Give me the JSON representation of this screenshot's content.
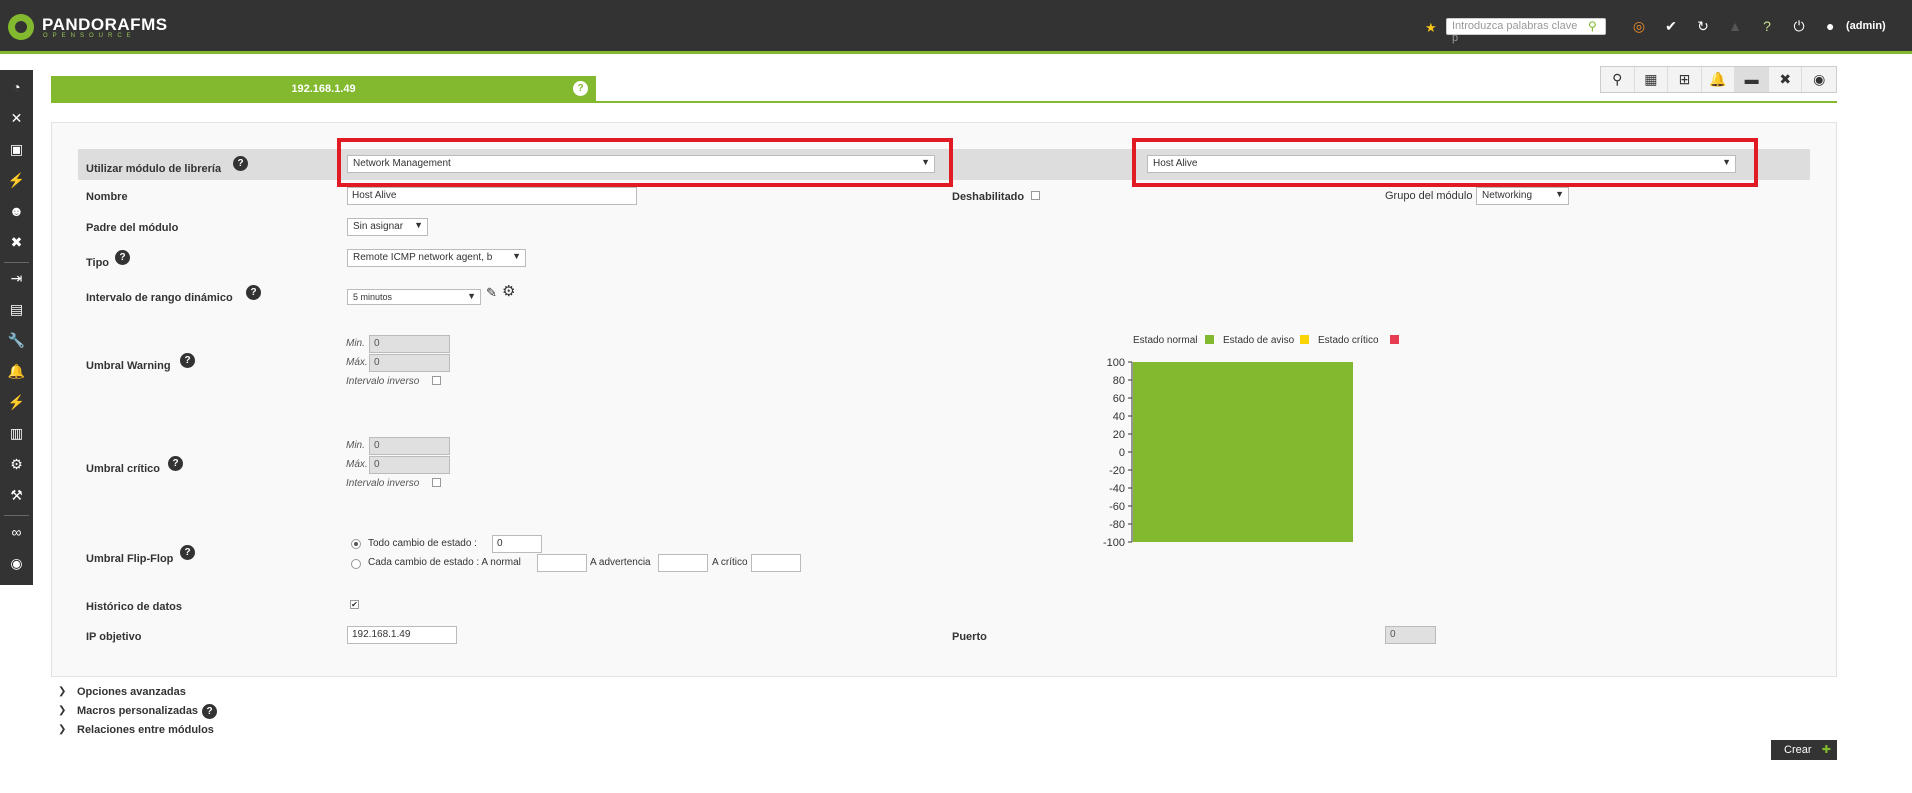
{
  "header": {
    "brand": "PANDORAFMS",
    "brand_sub": "OPENSOURCE",
    "search_placeholder": "Introduzca palabras clave p",
    "user": "(admin)"
  },
  "tab": {
    "title": "192.168.1.49",
    "help": "?"
  },
  "form": {
    "library_label": "Utilizar módulo de librería",
    "library_category": "Network Management",
    "library_module": "Host Alive",
    "name_label": "Nombre",
    "name_value": "Host Alive",
    "disabled_label": "Deshabilitado",
    "module_group_label": "Grupo del módulo",
    "module_group_value": "Networking",
    "parent_label": "Padre del módulo",
    "parent_value": "Sin asignar",
    "type_label": "Tipo",
    "type_value": "Remote ICMP network agent, b",
    "interval_label": "Intervalo de rango dinámico",
    "interval_value": "5 minutos",
    "warning_label": "Umbral Warning",
    "critical_label": "Umbral crítico",
    "min_label": "Min.",
    "max_label": "Máx.",
    "inverse_label": "Intervalo inverso",
    "warning_min": "0",
    "warning_max": "0",
    "critical_min": "0",
    "critical_max": "0",
    "flipflop_label": "Umbral Flip-Flop",
    "flip_option1": "Todo cambio de estado :",
    "flip_option1_value": "0",
    "flip_option2": "Cada cambio de estado : A normal",
    "flip_warning": "A advertencia",
    "flip_critical": "A crítico",
    "history_label": "Histórico de datos",
    "ip_label": "IP objetivo",
    "ip_value": "192.168.1.49",
    "port_label": "Puerto",
    "port_value": "0"
  },
  "chart_data": {
    "type": "area",
    "legend": [
      {
        "name": "Estado normal",
        "color": "#82b92e"
      },
      {
        "name": "Estado de aviso",
        "color": "#fad403"
      },
      {
        "name": "Estado crítico",
        "color": "#e63c52"
      }
    ],
    "y_ticks": [
      "100",
      "80",
      "60",
      "40",
      "20",
      "0",
      "-20",
      "-40",
      "-60",
      "-80",
      "-100"
    ],
    "ylim": [
      -100,
      100
    ],
    "series": [
      {
        "name": "Estado normal",
        "from": -100,
        "to": 100
      }
    ]
  },
  "expanders": [
    "Opciones avanzadas",
    "Macros personalizadas",
    "Relaciones entre módulos"
  ],
  "create_button": "Crear"
}
